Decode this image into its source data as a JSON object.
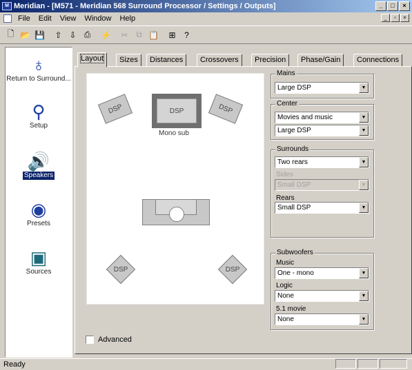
{
  "window": {
    "title": "Meridian - [M571 - Meridian 568 Surround Processor / Settings / Outputs]",
    "app_icon": "M"
  },
  "menu": [
    "File",
    "Edit",
    "View",
    "Window",
    "Help"
  ],
  "toolbar": {
    "icons": [
      "new-icon",
      "open-icon",
      "save-icon",
      "upload-icon",
      "download-icon",
      "print-icon",
      "connect-icon",
      "cut-icon",
      "copy-icon",
      "paste-icon",
      "help-icon",
      "whats-this-icon"
    ]
  },
  "nav": {
    "items": [
      {
        "label": "Return to Surround...",
        "icon": "return-icon",
        "selected": false
      },
      {
        "label": "Setup",
        "icon": "magnifier-icon",
        "selected": false
      },
      {
        "label": "Speakers",
        "icon": "speaker-icon",
        "selected": true
      },
      {
        "label": "Presets",
        "icon": "presets-icon",
        "selected": false
      },
      {
        "label": "Sources",
        "icon": "sources-icon",
        "selected": false
      }
    ]
  },
  "tabs": [
    "Layout",
    "Sizes",
    "Distances",
    "Crossovers",
    "Precision",
    "Phase/Gain",
    "Connections"
  ],
  "active_tab": "Layout",
  "room": {
    "dsp_label": "DSP",
    "center_caption": "Mono sub"
  },
  "groups": {
    "mains": {
      "title": "Mains",
      "value": "Large DSP"
    },
    "center": {
      "title": "Center",
      "values": [
        "Movies and music",
        "Large DSP"
      ]
    },
    "surrounds": {
      "title": "Surrounds",
      "value": "Two rears",
      "sides_label": "Sides",
      "sides_value": "Small DSP",
      "rears_label": "Rears",
      "rears_value": "Small DSP"
    },
    "subwoofers": {
      "title": "Subwoofers",
      "music_label": "Music",
      "music_value": "One - mono",
      "logic_label": "Logic",
      "logic_value": "None",
      "fivepointone_label": "5.1 movie",
      "fivepointone_value": "None"
    }
  },
  "advanced": {
    "label": "Advanced",
    "checked": false
  },
  "status": {
    "text": "Ready"
  }
}
